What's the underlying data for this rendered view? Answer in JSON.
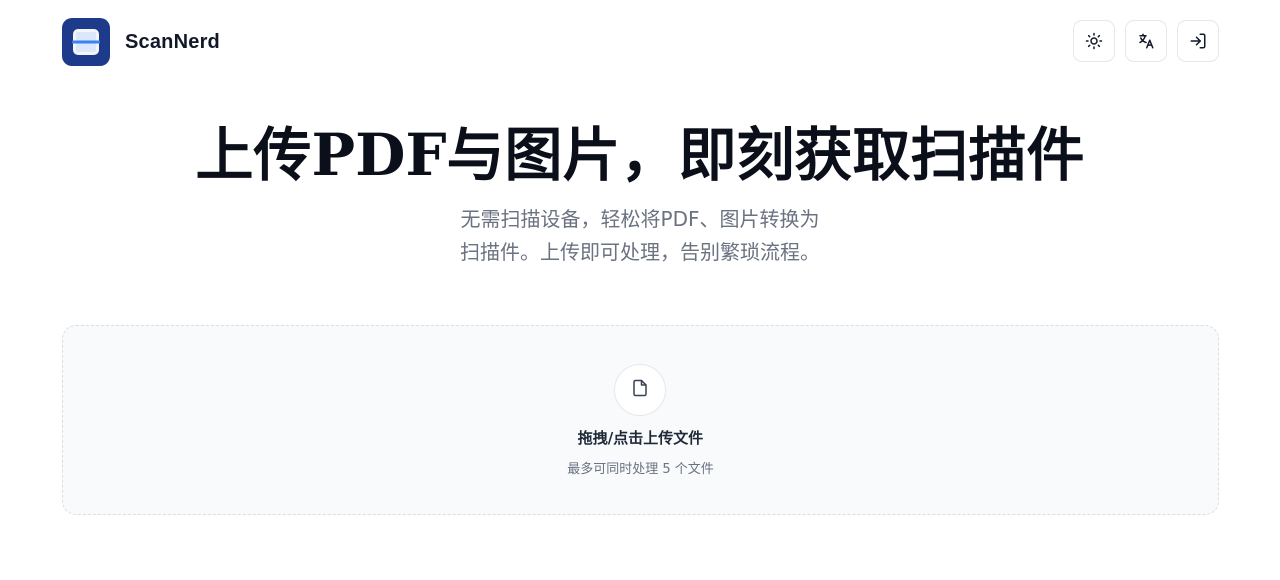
{
  "brand": {
    "name": "ScanNerd",
    "logo_color": "#1e3a8a"
  },
  "header": {
    "actions": [
      {
        "icon": "sun-icon",
        "label": "theme"
      },
      {
        "icon": "translate-icon",
        "label": "language"
      },
      {
        "icon": "login-icon",
        "label": "sign-in"
      }
    ]
  },
  "hero": {
    "title": "上传PDF与图片，即刻获取扫描件",
    "subtitle_line1": "无需扫描设备，轻松将PDF、图片转换为",
    "subtitle_line2": "扫描件。上传即可处理，告别繁琐流程。"
  },
  "dropzone": {
    "icon": "file-icon",
    "title": "拖拽/点击上传文件",
    "hint": "最多可同时处理 5 个文件"
  },
  "colors": {
    "title": "#0b0f19",
    "muted": "#6b7280",
    "border": "#e5e7eb",
    "dropzone_bg": "#f8fafc"
  }
}
